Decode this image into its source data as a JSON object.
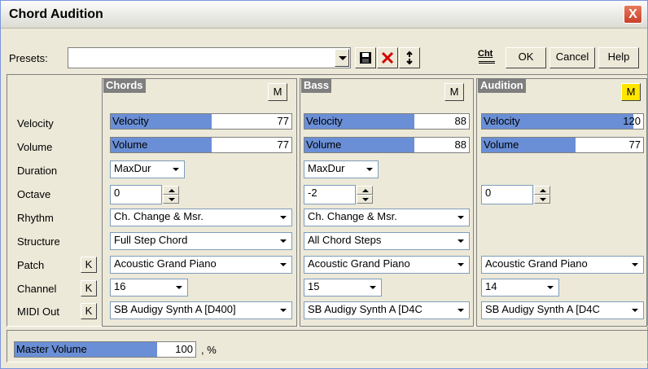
{
  "window": {
    "title": "Chord Audition",
    "close": "X"
  },
  "toolbar": {
    "presets_label": "Presets:",
    "presets_value": "",
    "chart_label": "Cht",
    "ok": "OK",
    "cancel": "Cancel",
    "help": "Help"
  },
  "row_labels": {
    "velocity": "Velocity",
    "volume": "Volume",
    "duration": "Duration",
    "octave": "Octave",
    "rhythm": "Rhythm",
    "structure": "Structure",
    "patch": "Patch",
    "channel": "Channel",
    "midi_out": "MIDI Out",
    "k": "K"
  },
  "chords": {
    "title": "Chords",
    "m": "M",
    "velocity": {
      "label": "Velocity",
      "value": "77",
      "fraction": 0.6
    },
    "volume": {
      "label": "Volume",
      "value": "77",
      "fraction": 0.6
    },
    "duration": "MaxDur",
    "octave": "0",
    "rhythm": "Ch. Change & Msr.",
    "structure": "Full Step Chord",
    "patch": "Acoustic Grand Piano",
    "channel": "16",
    "midi_out": "SB Audigy Synth A [D400]"
  },
  "bass": {
    "title": "Bass",
    "m": "M",
    "velocity": {
      "label": "Velocity",
      "value": "88",
      "fraction": 0.69
    },
    "volume": {
      "label": "Volume",
      "value": "88",
      "fraction": 0.69
    },
    "duration": "MaxDur",
    "octave": "-2",
    "rhythm": "Ch. Change & Msr.",
    "structure": "All Chord Steps",
    "patch": "Acoustic Grand Piano",
    "channel": "15",
    "midi_out": "SB Audigy Synth A [D4C"
  },
  "audition": {
    "title": "Audition",
    "m": "M",
    "velocity": {
      "label": "Velocity",
      "value": "120",
      "fraction": 0.94
    },
    "volume": {
      "label": "Volume",
      "value": "77",
      "fraction": 0.6
    },
    "octave": "0",
    "patch": "Acoustic Grand Piano",
    "channel": "14",
    "midi_out": "SB Audigy Synth A [D4C"
  },
  "master": {
    "label": "Master Volume",
    "value": "100",
    "unit": ", %",
    "fraction": 0.79
  },
  "colors": {
    "slider_fill": "#6a8fd6",
    "m_active": "#ffe600",
    "close": "#d2492f"
  }
}
